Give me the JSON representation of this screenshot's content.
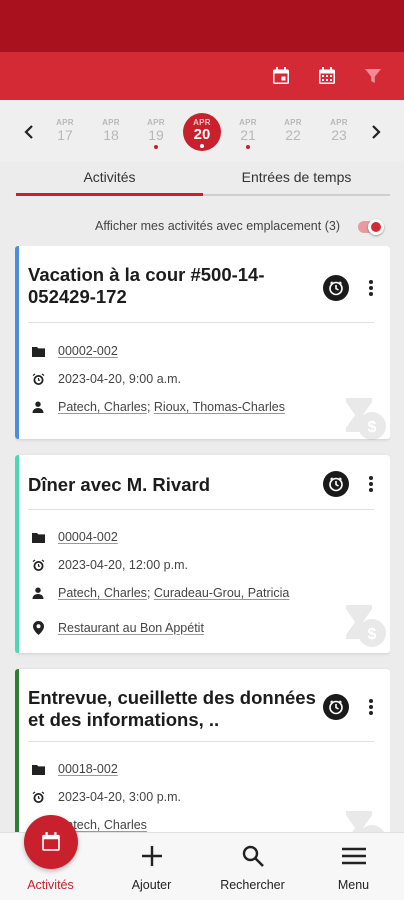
{
  "colors": {
    "brand": "#c8202c",
    "status_bar": "#a8111d",
    "toolbar": "#d42a35"
  },
  "toolbar": {
    "icons": [
      "calendar-today-icon",
      "calendar-month-icon",
      "filter-icon"
    ]
  },
  "date_strip": {
    "prev_icon": "chevron-left-icon",
    "next_icon": "chevron-right-icon",
    "days": [
      {
        "month": "APR",
        "day": "17",
        "dot": false,
        "selected": false
      },
      {
        "month": "APR",
        "day": "18",
        "dot": false,
        "selected": false
      },
      {
        "month": "APR",
        "day": "19",
        "dot": true,
        "selected": false
      },
      {
        "month": "APR",
        "day": "20",
        "dot": true,
        "selected": true
      },
      {
        "month": "APR",
        "day": "21",
        "dot": true,
        "selected": false
      },
      {
        "month": "APR",
        "day": "22",
        "dot": false,
        "selected": false
      },
      {
        "month": "APR",
        "day": "23",
        "dot": false,
        "selected": false
      }
    ]
  },
  "tabs": [
    {
      "label": "Activités",
      "active": true
    },
    {
      "label": "Entrées de temps",
      "active": false
    }
  ],
  "filter": {
    "label": "Afficher mes activités avec emplacement (3)",
    "toggle_on": true
  },
  "cards": [
    {
      "title": "Vacation à la cour #500-14-052429-172",
      "accent": "#4a8fd8",
      "file": "00002-002",
      "datetime": "2023-04-20, 9:00 a.m.",
      "people": [
        "Patech, Charles",
        "Rioux, Thomas-Charles"
      ],
      "location": ""
    },
    {
      "title": "Dîner avec M. Rivard",
      "accent": "#4fd6b4",
      "file": "00004-002",
      "datetime": "2023-04-20, 12:00 p.m.",
      "people": [
        "Patech, Charles",
        "Curadeau-Grou, Patricia"
      ],
      "location": "Restaurant au Bon Appétit"
    },
    {
      "title": "Entrevue, cueillette des données et des informations, ..",
      "accent": "#2e7d32",
      "file": "00018-002",
      "datetime": "2023-04-20, 3:00 p.m.",
      "people": [
        "Patech, Charles"
      ],
      "location": ""
    }
  ],
  "bottom_nav": [
    {
      "label": "Activités",
      "icon": "calendar-icon",
      "active": true
    },
    {
      "label": "Ajouter",
      "icon": "plus-icon",
      "active": false
    },
    {
      "label": "Rechercher",
      "icon": "search-icon",
      "active": false
    },
    {
      "label": "Menu",
      "icon": "menu-icon",
      "active": false
    }
  ]
}
